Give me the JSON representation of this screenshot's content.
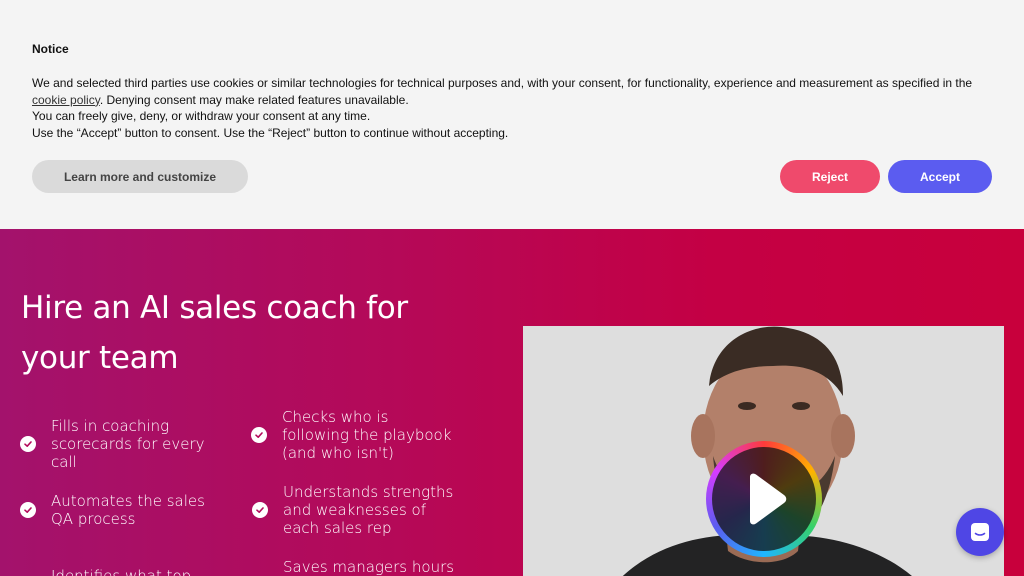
{
  "notice": {
    "title": "Notice",
    "line1_pre": "We and selected third parties use cookies or similar technologies for technical purposes and, with your consent, for functionality, experience and measurement as specified in the",
    "cookie_link": "cookie policy",
    "line1_post": ". Denying consent may make related features unavailable.",
    "line2": "You can freely give, deny, or withdraw your consent at any time.",
    "line3": "Use the “Accept” button to consent. Use the “Reject” button to continue without accepting.",
    "learn_label": "Learn more and customize",
    "reject_label": "Reject",
    "accept_label": "Accept"
  },
  "hero": {
    "title": "Hire an AI sales coach for your team",
    "features": [
      "Fills in coaching scorecards for every call",
      "Checks who is following the playbook (and who isn't)",
      "Automates the sales QA process",
      "Understands strengths and weaknesses of each sales rep",
      "Identifies what top",
      "Saves managers hours"
    ]
  },
  "video": {
    "play_icon": "play-icon"
  },
  "chat": {
    "icon": "chat-icon"
  },
  "colors": {
    "reject": "#ef4a6c",
    "accept": "#5b5cf0",
    "hero_start": "#a3126c",
    "hero_end": "#c8003c",
    "chat": "#4f46e5"
  }
}
